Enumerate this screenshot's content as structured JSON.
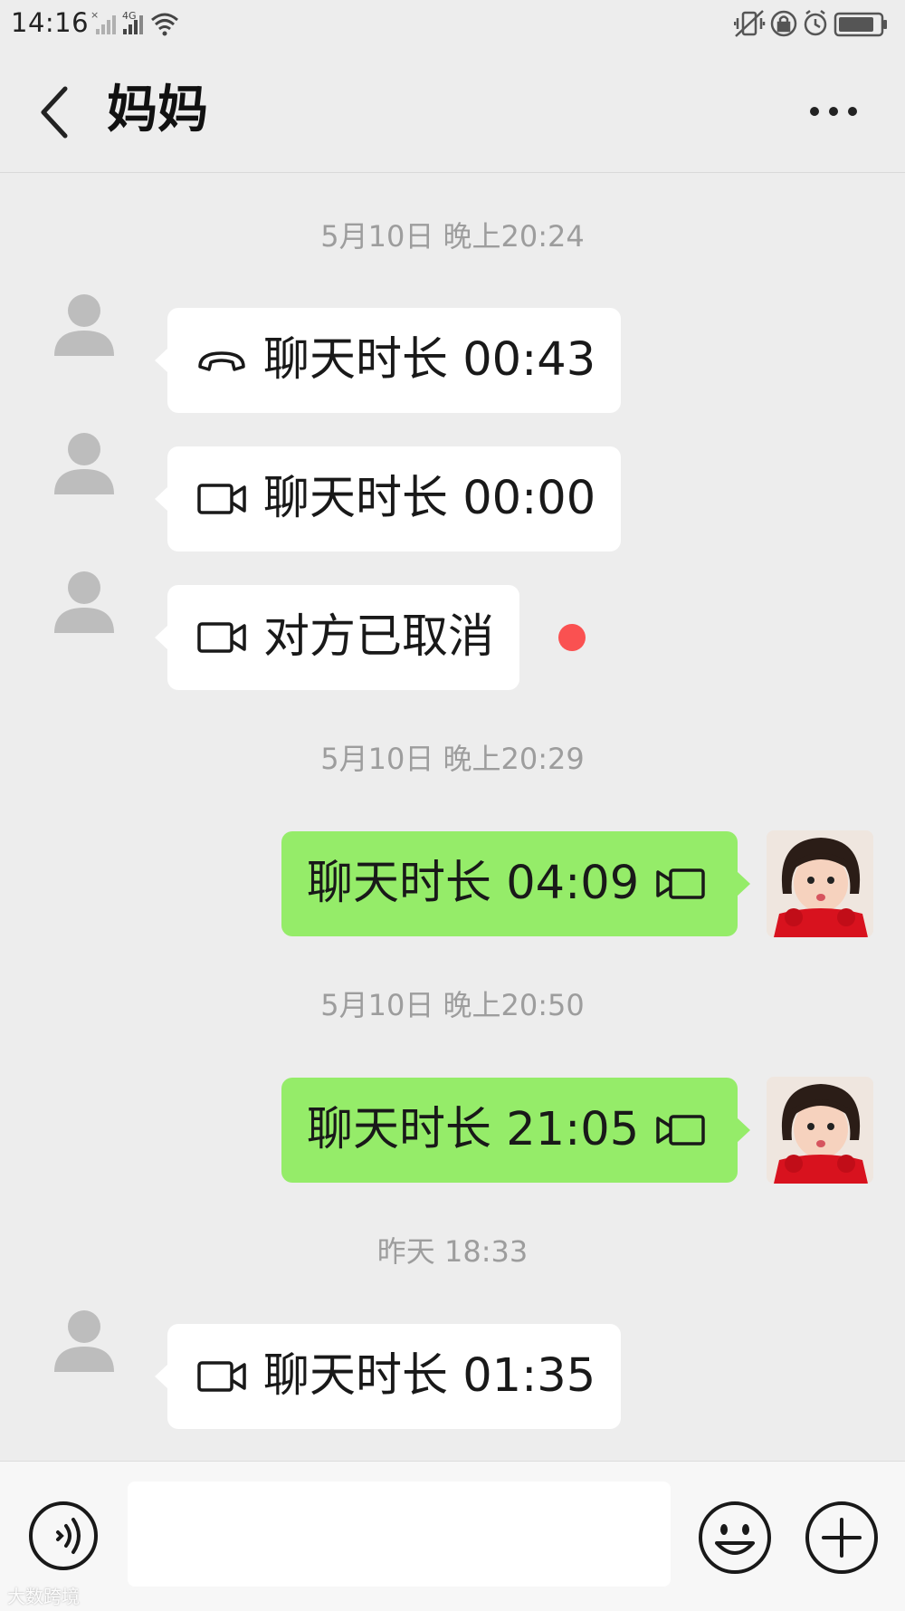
{
  "status_bar": {
    "time": "14:16",
    "network": "4G",
    "icons": [
      "no-signal-icon",
      "signal-icon",
      "wifi-icon",
      "vibrate-icon",
      "lock-rotation-icon",
      "alarm-icon",
      "battery-icon"
    ]
  },
  "header": {
    "title": "妈妈",
    "back_icon": "chevron-left-icon",
    "more_icon": "more-dots-icon"
  },
  "messages": [
    {
      "type": "timestamp",
      "text": "5月10日 晚上20:24"
    },
    {
      "type": "incoming",
      "icon": "voice-call-icon",
      "text": "聊天时长 00:43"
    },
    {
      "type": "incoming",
      "icon": "video-call-icon",
      "text": "聊天时长 00:00"
    },
    {
      "type": "incoming",
      "icon": "video-call-icon",
      "text": "对方已取消",
      "unread": true
    },
    {
      "type": "timestamp",
      "text": "5月10日 晚上20:29"
    },
    {
      "type": "outgoing",
      "icon": "video-call-icon",
      "text": "聊天时长 04:09"
    },
    {
      "type": "timestamp",
      "text": "5月10日 晚上20:50"
    },
    {
      "type": "outgoing",
      "icon": "video-call-icon",
      "text": "聊天时长 21:05"
    },
    {
      "type": "timestamp",
      "text": "昨天 18:33"
    },
    {
      "type": "incoming",
      "icon": "video-call-icon",
      "text": "聊天时长 01:35"
    }
  ],
  "input_bar": {
    "value": "",
    "icons": [
      "voice-input-icon",
      "emoji-icon",
      "plus-icon"
    ]
  },
  "watermark": "大数跨境",
  "colors": {
    "background": "#ededed",
    "outgoing_bubble": "#95ec69",
    "incoming_bubble": "#ffffff",
    "timestamp": "#9d9d9d",
    "unread_dot": "#fa5151"
  }
}
